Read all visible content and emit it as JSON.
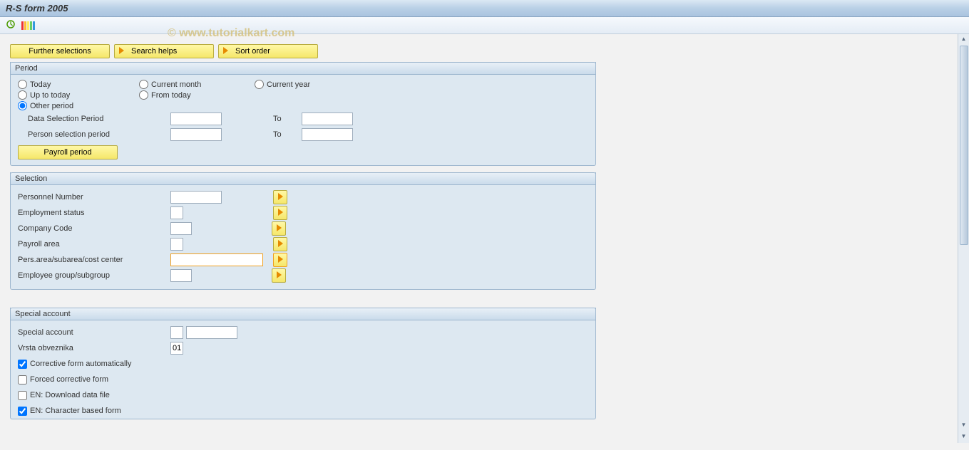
{
  "title": "R-S form 2005",
  "watermark": "© www.tutorialkart.com",
  "toolbar": {
    "further_selections": "Further selections",
    "search_helps": "Search helps",
    "sort_order": "Sort order"
  },
  "period": {
    "title": "Period",
    "today": "Today",
    "current_month": "Current month",
    "current_year": "Current year",
    "up_to_today": "Up to today",
    "from_today": "From today",
    "other_period": "Other period",
    "data_selection_period": "Data Selection Period",
    "person_selection_period": "Person selection period",
    "to": "To",
    "payroll_period": "Payroll period"
  },
  "selection": {
    "title": "Selection",
    "personnel_number": "Personnel Number",
    "employment_status": "Employment status",
    "company_code": "Company Code",
    "payroll_area": "Payroll area",
    "pers_area": "Pers.area/subarea/cost center",
    "employee_group": "Employee group/subgroup"
  },
  "special": {
    "title": "Special account",
    "special_account": "Special account",
    "vrsta": "Vrsta obveznika",
    "vrsta_val": "01",
    "corrective_auto": "Corrective form automatically",
    "forced_corrective": "Forced corrective form",
    "en_download": "EN: Download data file",
    "en_char": "EN: Character based form"
  }
}
